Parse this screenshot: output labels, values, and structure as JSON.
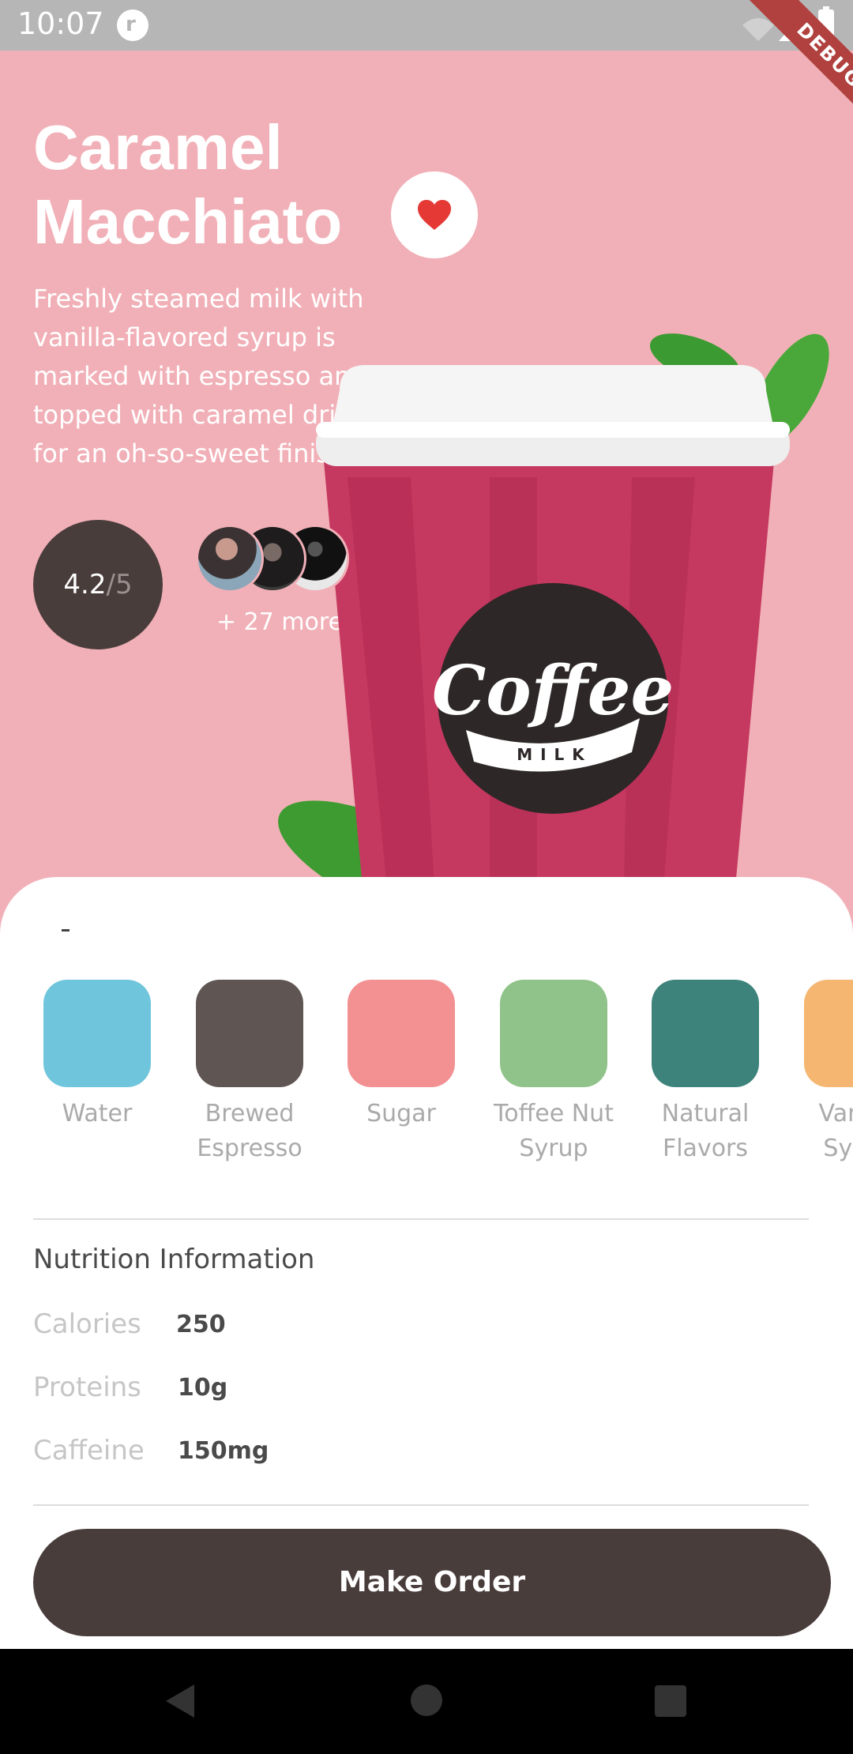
{
  "status_bar": {
    "time": "10:07",
    "debug_label": "DEBUG"
  },
  "product": {
    "title": "Caramel Macchiato",
    "description": "Freshly steamed milk with vanilla-flavored syrup is marked with espresso and topped with caramel drizzle for an oh-so-sweet finish.",
    "rating": "4.2",
    "rating_out_of": "/5",
    "more_reviewers": "+ 27 more",
    "cup_brand_logo": "Coffee",
    "cup_brand_sub": "MILK"
  },
  "colors": {
    "hero_bg": "#f1b0b7",
    "dark_brown": "#493d3b",
    "heart_red": "#e53935"
  },
  "ingredients": [
    {
      "label": "Water",
      "color": "#6fc5dc"
    },
    {
      "label": "Brewed Espresso",
      "color": "#5f5553"
    },
    {
      "label": "Sugar",
      "color": "#f29092"
    },
    {
      "label": "Toffee Nut Syrup",
      "color": "#90c38a"
    },
    {
      "label": "Natural Flavors",
      "color": "#3d837c"
    },
    {
      "label": "Vanilla Syrup",
      "color": "#f5b671"
    }
  ],
  "nutrition": {
    "title": "Nutrition Information",
    "rows": [
      {
        "label": "Calories",
        "value": "250"
      },
      {
        "label": "Proteins",
        "value": "10g"
      },
      {
        "label": "Caffeine",
        "value": "150mg"
      }
    ]
  },
  "order_button": {
    "label": "Make Order"
  },
  "icons": [
    "app-icon",
    "signal-icon",
    "battery-icon",
    "heart-icon",
    "back-icon",
    "home-icon",
    "recents-icon"
  ]
}
